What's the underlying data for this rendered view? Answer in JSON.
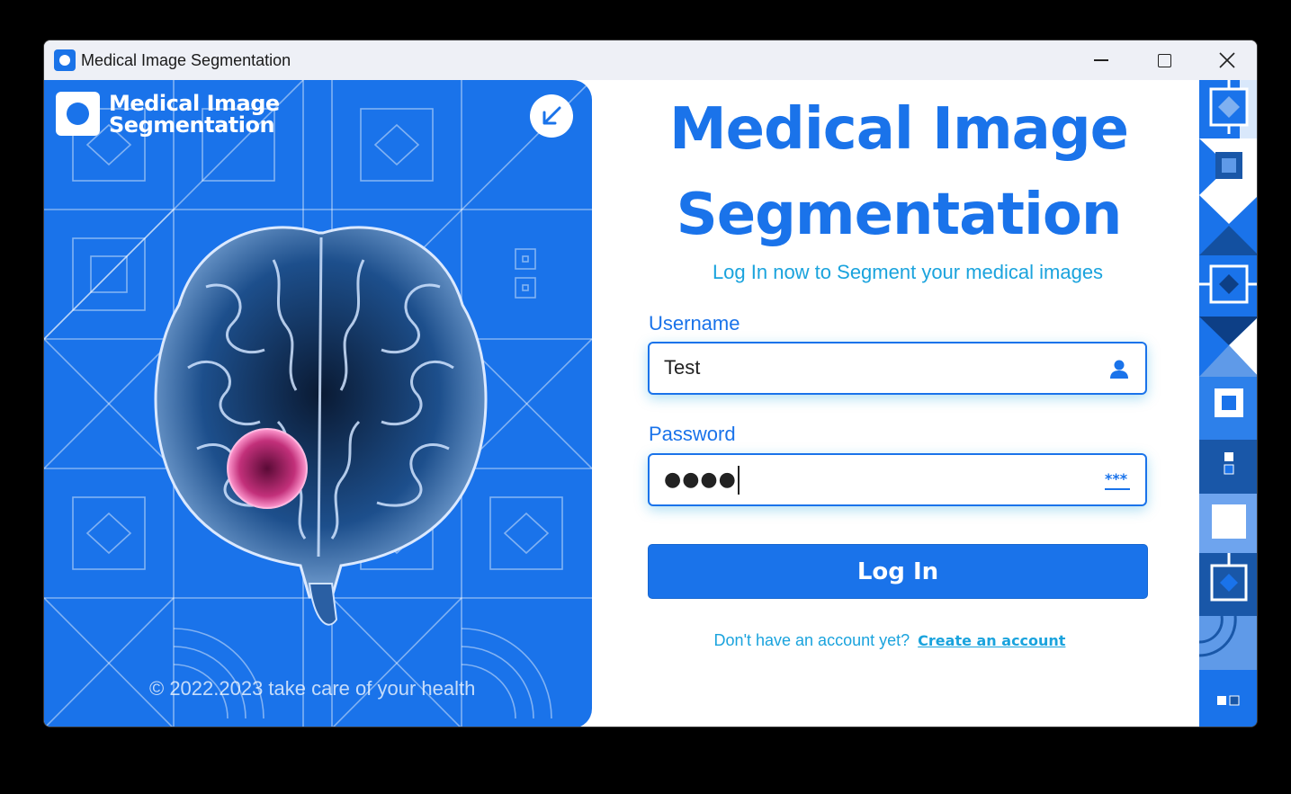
{
  "window": {
    "title": "Medical Image Segmentation",
    "controls": [
      "minimize",
      "maximize",
      "close"
    ]
  },
  "left_panel": {
    "brand_line1": "Medical Image",
    "brand_line2": "Segmentation",
    "footer": "© 2022.2023 take care of your health",
    "collapse_icon": "arrow-down-left-icon"
  },
  "form": {
    "title_line1": "Medical Image",
    "title_line2": "Segmentation",
    "subtitle": "Log In now to Segment your medical images",
    "username_label": "Username",
    "username_value": "Test",
    "username_icon": "user-icon",
    "password_label": "Password",
    "password_masked": "●●●●",
    "password_icon": "password-dots-icon",
    "login_label": "Log In",
    "signup_prompt": "Don't have an account yet?",
    "signup_link": "Create an account"
  },
  "colors": {
    "primary": "#1a73ea",
    "accent": "#1aa3dd",
    "titlebar": "#eef0f6"
  }
}
